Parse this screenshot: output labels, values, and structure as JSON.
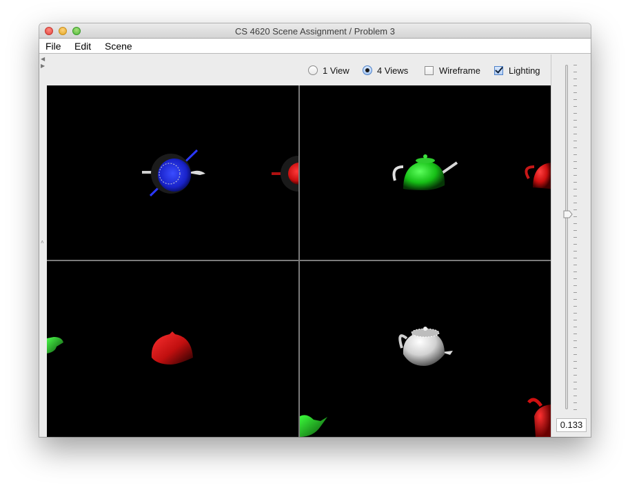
{
  "window": {
    "title": "CS 4620 Scene Assignment / Problem 3"
  },
  "menu": {
    "items": [
      {
        "label": "File"
      },
      {
        "label": "Edit"
      },
      {
        "label": "Scene"
      }
    ]
  },
  "toolbar": {
    "view_mode": {
      "one_view_label": "1 View",
      "four_views_label": "4 Views",
      "selected": "4 Views"
    },
    "wireframe": {
      "label": "Wireframe",
      "checked": false
    },
    "lighting": {
      "label": "Lighting",
      "checked": true
    }
  },
  "slider": {
    "value": 0.133,
    "value_text": "0.133"
  },
  "colors": {
    "teapot_blue": "#1a25e6",
    "teapot_red": "#e01414",
    "teapot_green": "#18c418",
    "teapot_white": "#e8e8e8",
    "viewport_bg": "#000000",
    "divider": "#7b7b7b"
  },
  "icons": {
    "close": "close-icon",
    "minimize": "minimize-icon",
    "maximize": "maximize-icon",
    "collapse": "collapse-arrows-icon",
    "slider_thumb": "slider-thumb-icon"
  }
}
